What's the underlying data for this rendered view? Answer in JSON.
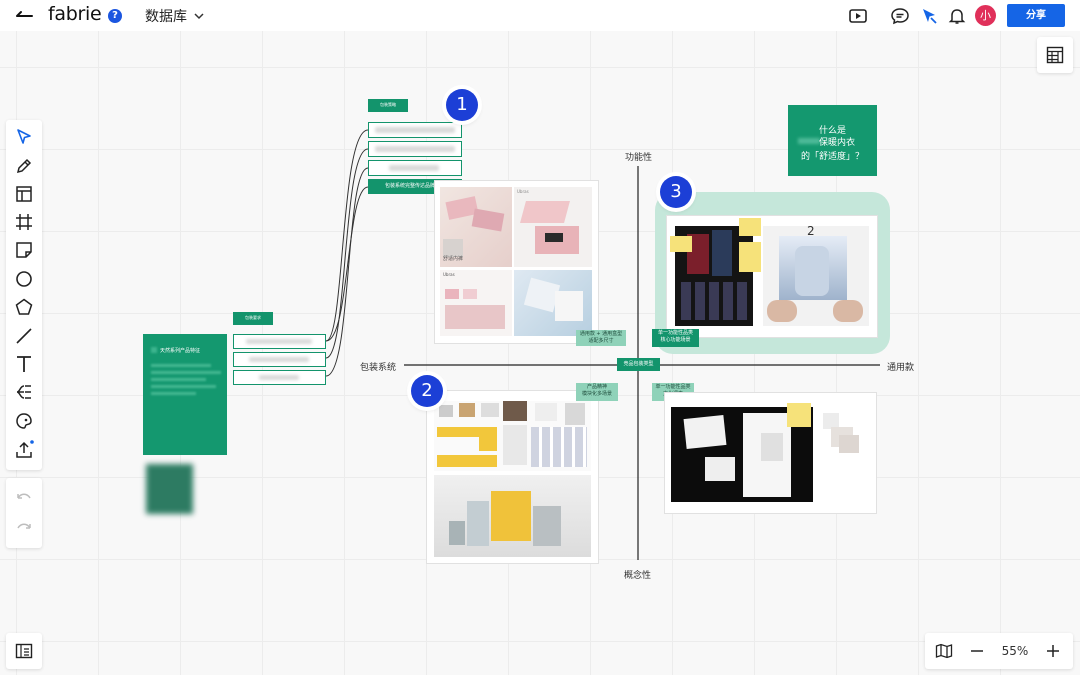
{
  "app": {
    "name": "fabrie",
    "doc_title": "数据库",
    "share_label": "分享",
    "avatar_initial": "小",
    "accent": "#1565e6",
    "help_glyph": "?"
  },
  "zoom": {
    "level": "55%"
  },
  "board": {
    "axis": {
      "top": "功能性",
      "bottom": "概念性",
      "left": "包装系统",
      "right": "通用款",
      "center": "竞品包装类型"
    },
    "badges": [
      "1",
      "2",
      "3"
    ],
    "question_card": {
      "line1": "什么是",
      "line2": "保暖内衣",
      "line3": "的「舒适度」？"
    },
    "left_card_title": "天然系列产品特征",
    "tags": {
      "packaging_strategy": "包装策略",
      "packaging_requirement": "包装要求",
      "brand_tone": "包装系统完整传达品牌气质",
      "general_plus_gift": "通用款 + 通用盒型\n适配多尺寸",
      "single_function_core": "单一功能性品类\n核心功能场景",
      "product_essence": "产品精神\n模块化多场景",
      "single_function_culture": "单一功能性品类\n文化调查"
    },
    "photo_text": {
      "brand_en": "Ubras",
      "brand_cn": "舒适内裤"
    },
    "colors": {
      "green": "#14986f",
      "mint": "#8fd2b9",
      "badge_blue": "#1c3fd6"
    }
  }
}
